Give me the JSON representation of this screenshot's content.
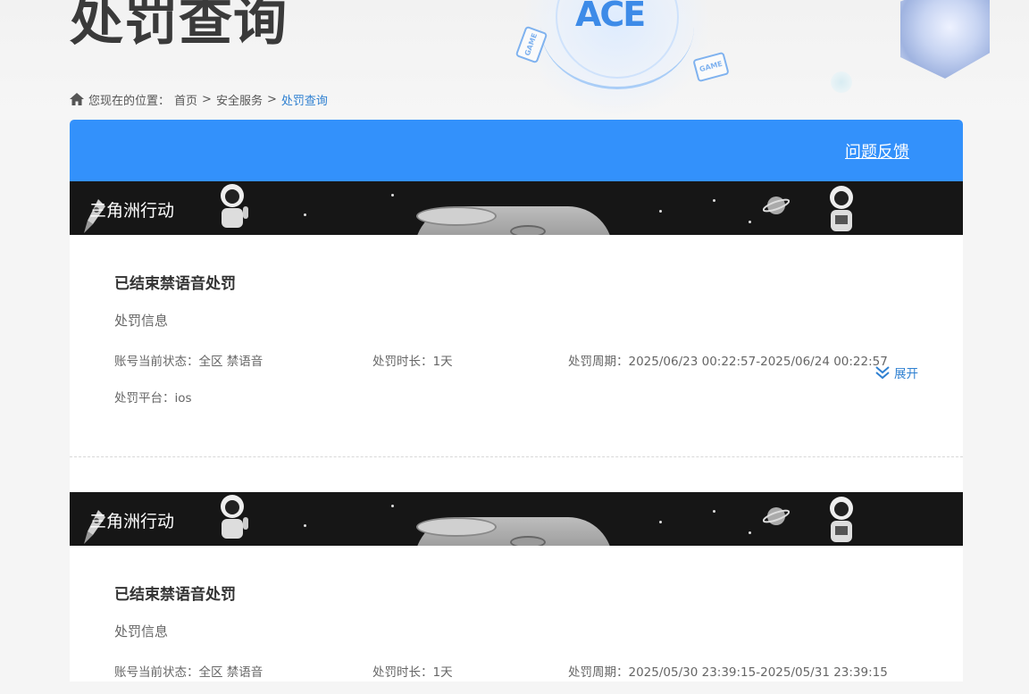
{
  "header": {
    "title": "处罚查询",
    "logo_text": "ACE",
    "game_tag": "GAME"
  },
  "breadcrumb": {
    "prefix": "您现在的位置：",
    "items": [
      "首页",
      "安全服务",
      "处罚查询"
    ],
    "separator": ">"
  },
  "topbar": {
    "feedback_label": "问题反馈",
    "color": "#3391fb"
  },
  "records": [
    {
      "game": "三角洲行动",
      "status_title": "已结束禁语音处罚",
      "section_label": "处罚信息",
      "account_status": "账号当前状态：全区 禁语音",
      "duration": "处罚时长：1天",
      "period": "处罚周期：2025/06/23 00:22:57-2025/06/24 00:22:57",
      "platform": "处罚平台：ios",
      "expand_label": "展开"
    },
    {
      "game": "三角洲行动",
      "status_title": "已结束禁语音处罚",
      "section_label": "处罚信息",
      "account_status": "账号当前状态：全区 禁语音",
      "duration": "处罚时长：1天",
      "period": "处罚周期：2025/05/30 23:39:15-2025/05/31 23:39:15"
    }
  ],
  "colors": {
    "accent": "#3391fb",
    "link": "#2f80d1",
    "banner_bg": "#161616"
  },
  "icons": {
    "home": "home-icon",
    "expand": "double-chevron-down-icon"
  }
}
